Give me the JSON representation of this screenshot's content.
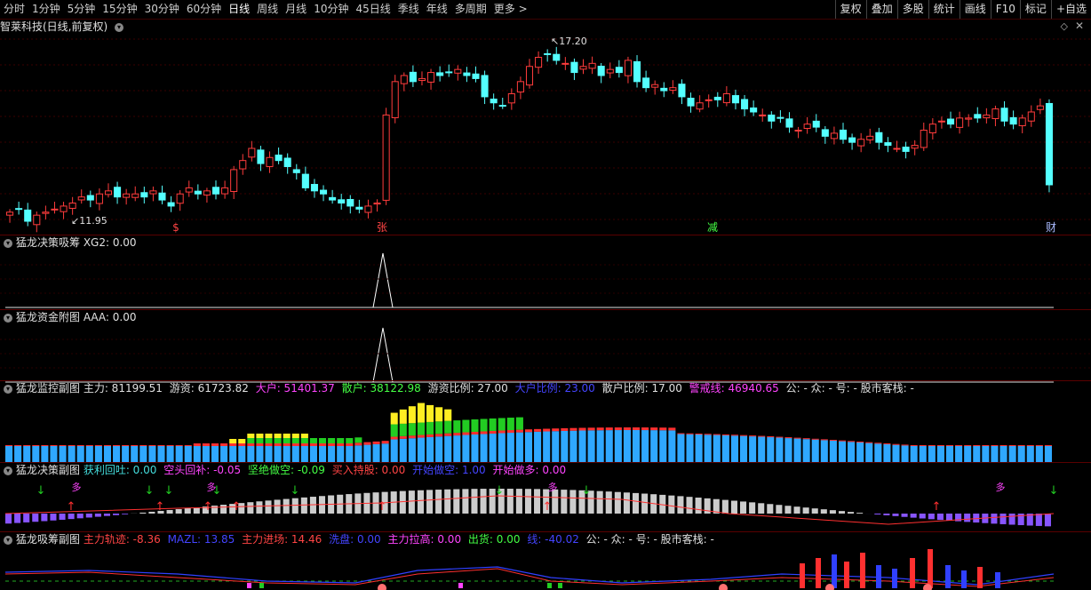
{
  "periods": [
    "分时",
    "1分钟",
    "5分钟",
    "15分钟",
    "30分钟",
    "60分钟",
    "日线",
    "周线",
    "月线",
    "10分钟",
    "45日线",
    "季线",
    "年线",
    "多周期",
    "更多 >"
  ],
  "tools": [
    "复权",
    "叠加",
    "多股",
    "统计",
    "画线",
    "F10",
    "标记",
    "+自选"
  ],
  "main": {
    "title": "智莱科技(日线,前复权)",
    "high_label": "17.20",
    "low_label": "11.95",
    "markers": [
      "$",
      "张",
      "减",
      "财"
    ]
  },
  "panel1": {
    "title": "猛龙决策吸筹",
    "items": [
      {
        "label": "XG2: 0.00",
        "color": "#e0e0e0"
      }
    ]
  },
  "panel2": {
    "title": "猛龙资金附图",
    "items": [
      {
        "label": "AAA: 0.00",
        "color": "#e0e0e0"
      }
    ]
  },
  "panel3": {
    "title": "猛龙监控副图",
    "items": [
      {
        "label": "主力: 81199.51",
        "color": "#e0e0e0"
      },
      {
        "label": "游资: 61723.82",
        "color": "#e0e0e0"
      },
      {
        "label": "大户: 51401.37",
        "color": "#ff44ff"
      },
      {
        "label": "散户: 38122.98",
        "color": "#44ff44"
      },
      {
        "label": "游资比例: 27.00",
        "color": "#e0e0e0"
      },
      {
        "label": "大户比例: 23.00",
        "color": "#4444ff"
      },
      {
        "label": "散户比例: 17.00",
        "color": "#e0e0e0"
      },
      {
        "label": "警戒线: 46940.65",
        "color": "#ff44ff"
      },
      {
        "label": "公: - 众: - 号: - 股市客栈: -",
        "color": "#e0e0e0"
      }
    ]
  },
  "panel4": {
    "title": "猛龙决策副图",
    "items": [
      {
        "label": "获利回吐: 0.00",
        "color": "#44dddd"
      },
      {
        "label": "空头回补: -0.05",
        "color": "#ff44ff"
      },
      {
        "label": "坚绝做空: -0.09",
        "color": "#44ff44"
      },
      {
        "label": "买入持股: 0.00",
        "color": "#ff4444"
      },
      {
        "label": "开始做空: 1.00",
        "color": "#4444ff"
      },
      {
        "label": "开始做多: 0.00",
        "color": "#ff44ff"
      }
    ],
    "tags": [
      "多",
      "多",
      "多",
      "多",
      "多"
    ]
  },
  "panel5": {
    "title": "猛龙吸筹副图",
    "items": [
      {
        "label": "主力轨迹: -8.36",
        "color": "#ff4444"
      },
      {
        "label": "MAZL: 13.85",
        "color": "#4444ff"
      },
      {
        "label": "主力进场: 14.46",
        "color": "#ff4444"
      },
      {
        "label": "洗盘: 0.00",
        "color": "#4444ff"
      },
      {
        "label": "主力拉高: 0.00",
        "color": "#ff44ff"
      },
      {
        "label": "出货: 0.00",
        "color": "#44ff44"
      },
      {
        "label": "线: -40.02",
        "color": "#4444ff"
      },
      {
        "label": "公: - 众: - 号: - 股市客栈: -",
        "color": "#e0e0e0"
      }
    ]
  },
  "colors": {
    "up": "#ff3c3c",
    "down": "#54ffff",
    "bg": "#000000",
    "grid": "#3a0000"
  }
}
